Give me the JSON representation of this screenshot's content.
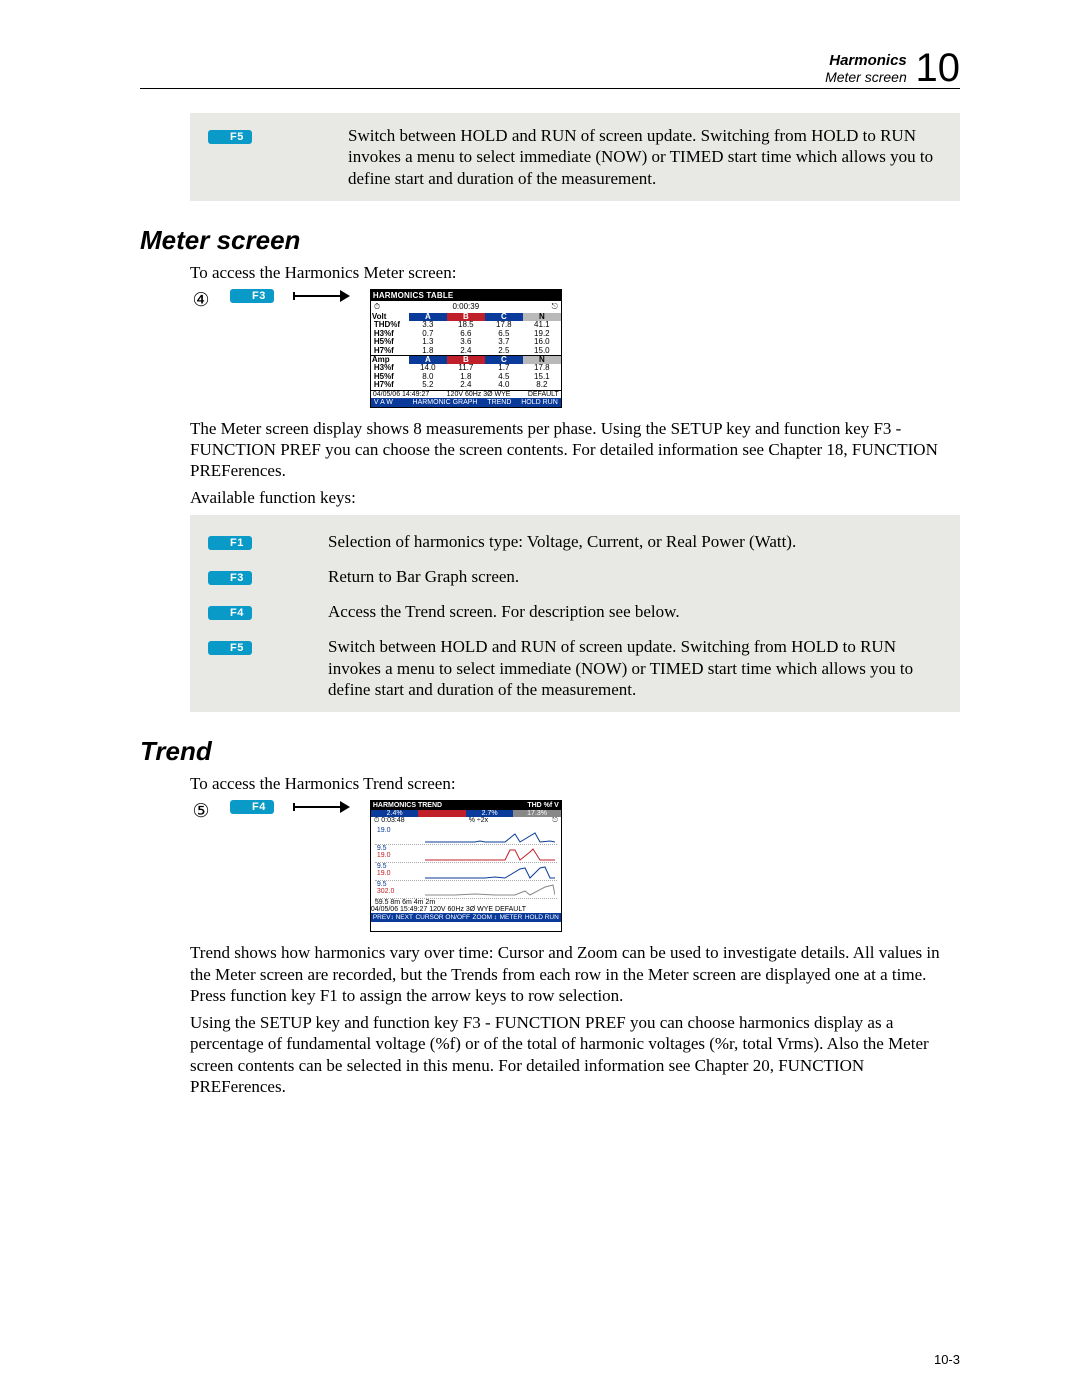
{
  "header": {
    "chapter_title": "Harmonics",
    "subtitle": "Meter screen",
    "chapter_number": "10"
  },
  "top_fkey": {
    "key": "F5",
    "desc": "Switch between HOLD and RUN of screen update. Switching from HOLD to RUN invokes a menu to select immediate (NOW) or TIMED start time which allows you to define start and duration of the measurement."
  },
  "meter_section": {
    "heading": "Meter screen",
    "intro": "To access the Harmonics Meter screen:",
    "step_number": "④",
    "step_key": "F3",
    "paragraph": "The Meter screen display shows 8 measurements per phase. Using the SETUP key and function key F3 - FUNCTION PREF you can choose the screen contents. For detailed information see Chapter 18, FUNCTION PREFerences.",
    "available_label": "Available function keys:",
    "fkeys": [
      {
        "key": "F1",
        "desc": "Selection of harmonics type: Voltage, Current, or Real Power (Watt)."
      },
      {
        "key": "F3",
        "desc": "Return to Bar Graph screen."
      },
      {
        "key": "F4",
        "desc": "Access the Trend screen. For description see below."
      },
      {
        "key": "F5",
        "desc": "Switch between HOLD and RUN of screen update. Switching from HOLD to RUN invokes a menu to select immediate (NOW) or TIMED start time which allows you to define start and duration of the measurement."
      }
    ]
  },
  "meter_screenshot": {
    "title": "HARMONICS TABLE",
    "time": "0:00:39",
    "volt_header": "Volt",
    "amp_header": "Amp",
    "cols": [
      "A",
      "B",
      "C",
      "N"
    ],
    "volt_rows": [
      {
        "label": "THD%f",
        "vals": [
          "3.3",
          "18.5",
          "17.8",
          "41.1"
        ]
      },
      {
        "label": "H3%f",
        "vals": [
          "0.7",
          "6.6",
          "6.5",
          "19.2"
        ]
      },
      {
        "label": "H5%f",
        "vals": [
          "1.3",
          "3.6",
          "3.7",
          "16.0"
        ]
      },
      {
        "label": "H7%f",
        "vals": [
          "1.8",
          "2.4",
          "2.5",
          "15.0"
        ]
      }
    ],
    "amp_rows": [
      {
        "label": "H3%f",
        "vals": [
          "14.0",
          "11.7",
          "1.7",
          "17.8"
        ]
      },
      {
        "label": "H5%f",
        "vals": [
          "8.0",
          "1.8",
          "4.5",
          "15.1"
        ]
      },
      {
        "label": "H7%f",
        "vals": [
          "5.2",
          "2.4",
          "4.0",
          "8.2"
        ]
      }
    ],
    "status_left": "04/05/06 14:49:27",
    "status_mid": "120V  60Hz 3Ø WYE",
    "status_right": "DEFAULT",
    "footer": [
      "V A W",
      "",
      "HARMONIC GRAPH",
      "TREND",
      "HOLD RUN"
    ]
  },
  "trend_section": {
    "heading": "Trend",
    "intro": "To access the Harmonics Trend screen:",
    "step_number": "⑤",
    "step_key": "F4",
    "paragraph1": "Trend shows how harmonics vary over time: Cursor and Zoom can be used to investigate details. All values in the Meter screen are recorded, but the Trends from each row in the Meter screen are displayed one at a time. Press function key F1 to assign the arrow keys to row selection.",
    "paragraph2": "Using the SETUP key and function key F3 - FUNCTION PREF you can choose harmonics display as a percentage of fundamental voltage (%f) or of the total of harmonic voltages (%r, total Vrms). Also the Meter screen contents can be selected in this menu. For detailed information see Chapter 20, FUNCTION PREFerences."
  },
  "trend_screenshot": {
    "title_left": "HARMONICS TREND",
    "title_right": "THD %f V",
    "phases": [
      "2.4%",
      "",
      "2.7%",
      "17.3%"
    ],
    "time": "0:03:48",
    "scale": "%  ÷2x",
    "row_labels": [
      {
        "a": "19.0",
        "b": ""
      },
      {
        "a": "9.5",
        "b": "19.0"
      },
      {
        "a": "9.5",
        "b": "19.0"
      },
      {
        "a": "9.5",
        "b": "302.0"
      }
    ],
    "xaxis": "59.5    8m    6m    4m    2m",
    "status_left": "04/05/06 15:49:27",
    "status_mid": "120V  60Hz 3Ø WYE",
    "status_right": "DEFAULT",
    "footer": [
      "PREV↕ NEXT",
      "CURSOR ON/OFF",
      "ZOOM ↕",
      "METER",
      "HOLD RUN"
    ]
  },
  "page_number": "10-3"
}
